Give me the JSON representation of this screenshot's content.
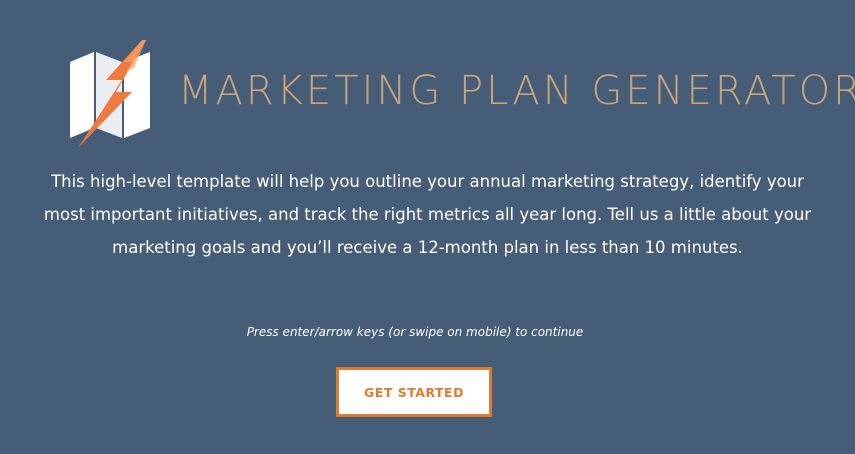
{
  "header": {
    "title": "MARKETING PLAN GENERATOR",
    "logo_icon": "lightning-map-icon"
  },
  "main": {
    "description": "This high-level template will help you outline your annual marketing strategy, identify your most important initiatives, and track the right metrics all year long. Tell us a little about your marketing goals and you’ll receive a 12-month plan in less than 10 minutes.",
    "hint": "Press enter/arrow keys (or swipe on mobile) to continue",
    "cta_label": "GET STARTED"
  },
  "colors": {
    "background": "#465d78",
    "title": "#c9a47a",
    "accent": "#e07a2c",
    "text": "#ffffff"
  }
}
